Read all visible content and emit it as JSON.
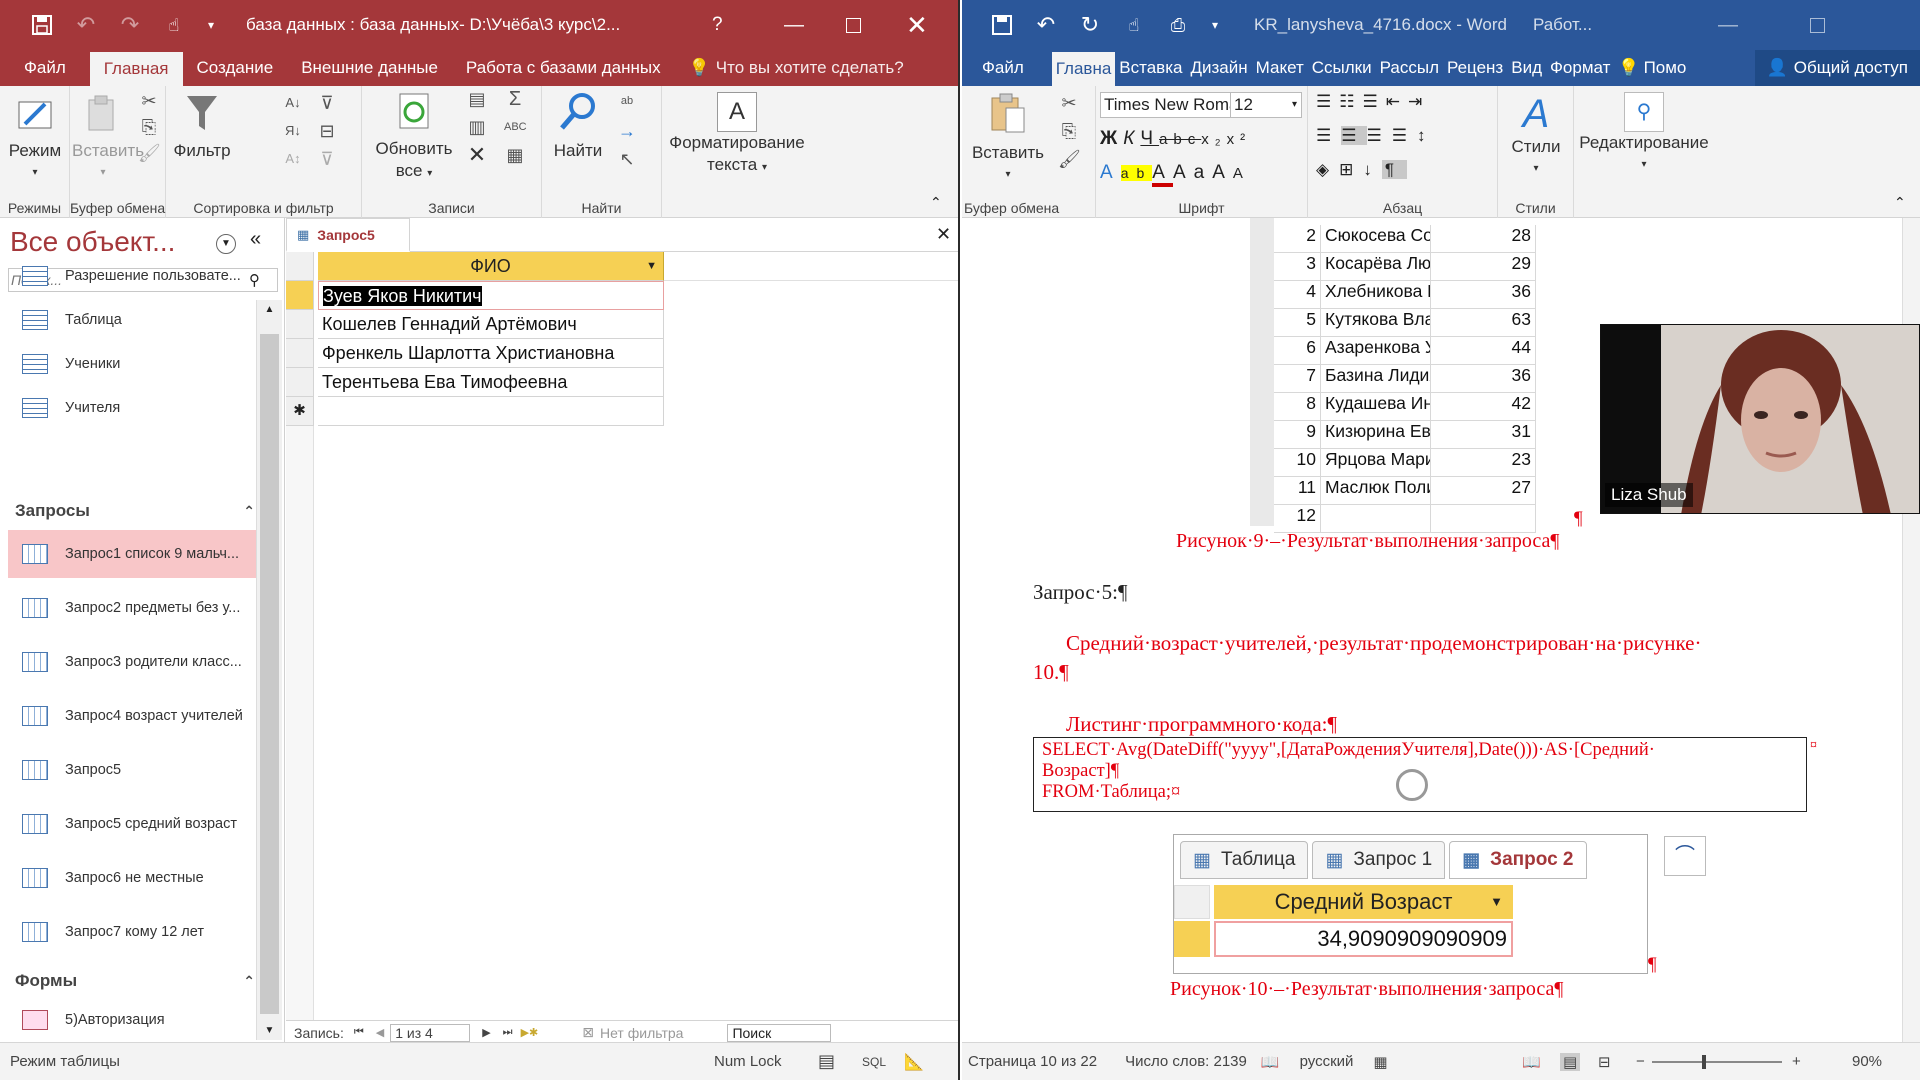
{
  "access": {
    "title": "база данных : база данных- D:\\Учёба\\3 курс\\2...",
    "help_label": "?",
    "tabs": [
      "Файл",
      "Главная",
      "Создание",
      "Внешние данные",
      "Работа с базами данных"
    ],
    "active_tab_index": 1,
    "tell_me": "Что вы хотите сделать?",
    "ribbon": {
      "mode_label": "Режим",
      "paste_label": "Вставить",
      "filter_label": "Фильтр",
      "refresh_label_1": "Обновить",
      "refresh_label_2": "все",
      "find_label": "Найти",
      "format_label_1": "Форматирование",
      "format_label_2": "текста",
      "groups": [
        "Режимы",
        "Буфер обмена",
        "Сортировка и фильтр",
        "Записи",
        "Найти"
      ]
    },
    "nav": {
      "header": "Все объект...",
      "search_placeholder": "Поиск...",
      "tables": [
        "Разрешение пользовате...",
        "Таблица",
        "Ученики",
        "Учителя"
      ],
      "queries_header": "Запросы",
      "queries": [
        "Запрос1 список 9 мальч...",
        "Запрос2 предметы без у...",
        "Запрос3 родители класс...",
        "Запрос4 возраст учителей",
        "Запрос5",
        "Запрос5 средний возраст",
        "Запрос6 не местные",
        "Запрос7 кому 12 лет"
      ],
      "selected_query_index": 0,
      "forms_header": "Формы",
      "forms": [
        "5)Авторизация"
      ]
    },
    "doc_tab": "Запрос5",
    "datasheet": {
      "column": "ФИО",
      "rows": [
        "Зуев Яков Никитич",
        "Кошелев Геннадий Артёмович",
        "Френкель Шарлотта Христиановна",
        "Терентьева Ева Тимофеевна"
      ],
      "new_row_marker": "✱"
    },
    "record_nav": {
      "label": "Запись:",
      "position": "1 из 4",
      "filter": "Нет фильтра",
      "search": "Поиск"
    },
    "status": {
      "left": "Режим таблицы",
      "numlock": "Num Lock",
      "sql": "SQL"
    }
  },
  "word": {
    "title": "KR_lanysheva_4716.docx - Word",
    "title_extra": "Работ...",
    "tabs": [
      "Файл",
      "Главна",
      "Вставка",
      "Дизайн",
      "Макет",
      "Ссылки",
      "Рассыл",
      "Реценз",
      "Вид",
      "Формат"
    ],
    "active_tab_index": 1,
    "help": "Помо",
    "share": "Общий доступ",
    "ribbon": {
      "paste_label": "Вставить",
      "font_name": "Times New Roman",
      "font_size": "12",
      "styles_label": "Стили",
      "editing_label": "Редактирование",
      "groups": [
        "Буфер обмена",
        "Шрифт",
        "Абзац",
        "Стили"
      ]
    },
    "results_table": [
      {
        "n": "2",
        "name": "Сюкосева Соф",
        "age": "28"
      },
      {
        "n": "3",
        "name": "Косарёва Люд",
        "age": "29"
      },
      {
        "n": "4",
        "name": "Хлебникова Р",
        "age": "36"
      },
      {
        "n": "5",
        "name": "Кутякова Влад",
        "age": "63"
      },
      {
        "n": "6",
        "name": "Азаренкова У.",
        "age": "44"
      },
      {
        "n": "7",
        "name": "Базина Лидия",
        "age": "36"
      },
      {
        "n": "8",
        "name": "Кудашева Инн",
        "age": "42"
      },
      {
        "n": "9",
        "name": "Кизюрина Евг",
        "age": "31"
      },
      {
        "n": "10",
        "name": "Ярцова Марин",
        "age": "23"
      },
      {
        "n": "11",
        "name": "Маслюк Поли",
        "age": "27"
      },
      {
        "n": "12",
        "name": "",
        "age": ""
      }
    ],
    "pilcrow": "¶",
    "caption9": "Рисунок·9·–·Результат·выполнения·запроса¶",
    "query_heading": "Запрос·5:¶",
    "para1": "Средний·возраст·учителей,·результат·продемонстрирован·на·рисунке·",
    "para1b": "10.¶",
    "listing": "Листинг·программного·кода:¶",
    "code_line1": "SELECT·Avg(DateDiff(\"yyyy\",[ДатаРожденияУчителя],Date()))·AS·[Средний·",
    "code_line2": "Возраст]¶",
    "code_line3": "FROM·Таблица;¤",
    "cell_marker": "¤",
    "embedded": {
      "tabs": [
        "Таблица",
        "Запрос 1",
        "Запрос 2"
      ],
      "active_tab_index": 2,
      "column": "Средний Возраст",
      "value": "34,9090909090909"
    },
    "caption10": "Рисунок·10·–·Результат·выполнения·запроса¶",
    "status": {
      "page": "Страница 10 из 22",
      "words": "Число слов: 2139",
      "lang": "русский",
      "zoom": "90%"
    }
  },
  "video": {
    "name": "Liza Shub"
  },
  "colors": {
    "access_red": "#a4373a",
    "word_blue": "#2b579a",
    "selection_pink": "#f8c6c8",
    "datasheet_header": "#f6d054",
    "word_red_text": "#e3000f"
  }
}
